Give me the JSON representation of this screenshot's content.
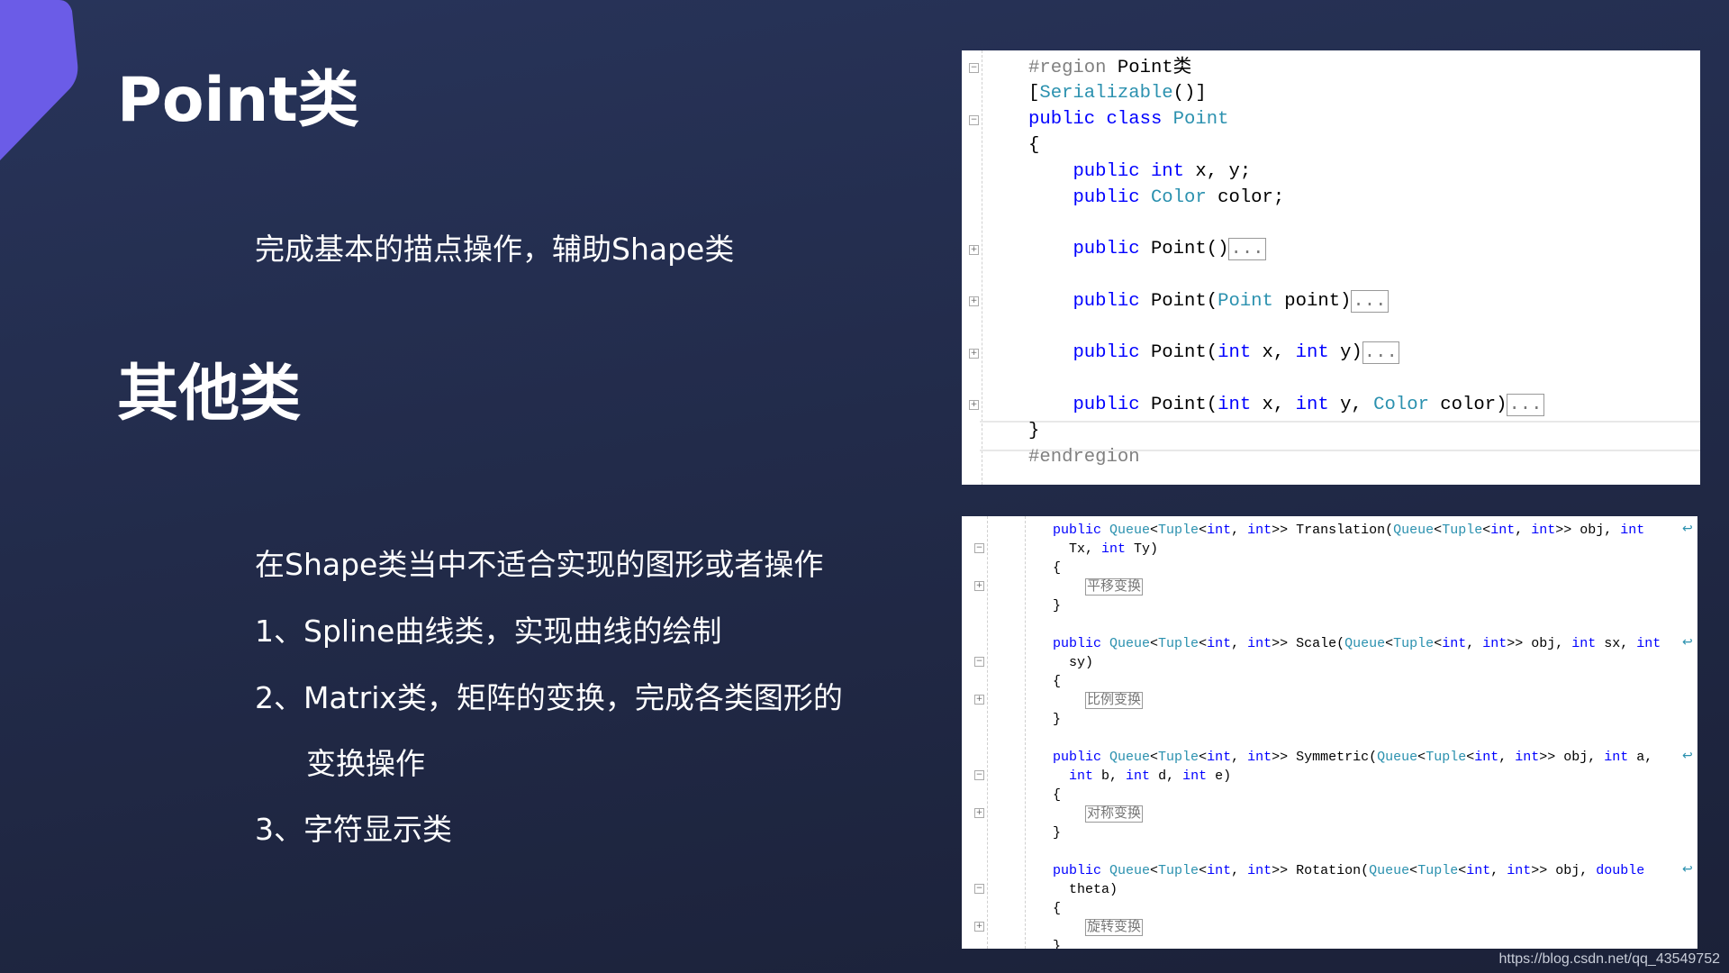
{
  "colors": {
    "accent": "#6b5ce7",
    "keyword": "#0000ff",
    "type": "#2b91af",
    "preprocessor": "#808080"
  },
  "slide": {
    "title1": "Point类",
    "desc1": "完成基本的描点操作，辅助Shape类",
    "title2": "其他类",
    "desc2": "在Shape类当中不适合实现的图形或者操作",
    "items": [
      "1、Spline曲线类，实现曲线的绘制",
      "2、Matrix类，矩阵的变换，完成各类图形的",
      "变换操作",
      "3、字符显示类"
    ]
  },
  "code_top": [
    [
      [
        "#region ",
        "pre"
      ],
      [
        "Point类",
        "pl"
      ]
    ],
    [
      [
        "[",
        "pl"
      ],
      [
        "Serializable",
        "ty"
      ],
      [
        "()]",
        "pl"
      ]
    ],
    [
      [
        "public class ",
        "kw"
      ],
      [
        "Point",
        "ty"
      ]
    ],
    [
      [
        "{",
        "pl"
      ]
    ],
    [
      [
        "    ",
        "pl"
      ],
      [
        "public int ",
        "kw"
      ],
      [
        "x, y;",
        "pl"
      ]
    ],
    [
      [
        "    ",
        "pl"
      ],
      [
        "public ",
        "kw"
      ],
      [
        "Color ",
        "ty"
      ],
      [
        "color;",
        "pl"
      ]
    ],
    [],
    [
      [
        "    ",
        "pl"
      ],
      [
        "public ",
        "kw"
      ],
      [
        "Point()",
        "pl"
      ],
      [
        "...",
        "col"
      ]
    ],
    [],
    [
      [
        "    ",
        "pl"
      ],
      [
        "public ",
        "kw"
      ],
      [
        "Point(",
        "pl"
      ],
      [
        "Point ",
        "ty"
      ],
      [
        "point)",
        "pl"
      ],
      [
        "...",
        "col"
      ]
    ],
    [],
    [
      [
        "    ",
        "pl"
      ],
      [
        "public ",
        "kw"
      ],
      [
        "Point(",
        "pl"
      ],
      [
        "int ",
        "kw"
      ],
      [
        "x, ",
        "pl"
      ],
      [
        "int ",
        "kw"
      ],
      [
        "y)",
        "pl"
      ],
      [
        "...",
        "col"
      ]
    ],
    [],
    [
      [
        "    ",
        "pl"
      ],
      [
        "public ",
        "kw"
      ],
      [
        "Point(",
        "pl"
      ],
      [
        "int ",
        "kw"
      ],
      [
        "x, ",
        "pl"
      ],
      [
        "int ",
        "kw"
      ],
      [
        "y, ",
        "pl"
      ],
      [
        "Color ",
        "ty"
      ],
      [
        "color)",
        "pl"
      ],
      [
        "...",
        "col"
      ]
    ],
    [
      [
        "}",
        "pl"
      ]
    ],
    [
      [
        "#endregion",
        "pre"
      ]
    ]
  ],
  "code_bottom": [
    [
      [
        "public ",
        "kw"
      ],
      [
        "Queue",
        "ty"
      ],
      [
        "<",
        "pl"
      ],
      [
        "Tuple",
        "ty"
      ],
      [
        "<",
        "pl"
      ],
      [
        "int",
        "kw"
      ],
      [
        ", ",
        "pl"
      ],
      [
        "int",
        "kw"
      ],
      [
        ">> Translation(",
        "pl"
      ],
      [
        "Queue",
        "ty"
      ],
      [
        "<",
        "pl"
      ],
      [
        "Tuple",
        "ty"
      ],
      [
        "<",
        "pl"
      ],
      [
        "int",
        "kw"
      ],
      [
        ", ",
        "pl"
      ],
      [
        "int",
        "kw"
      ],
      [
        ">> obj, ",
        "pl"
      ],
      [
        "int",
        "kw"
      ]
    ],
    [
      [
        "  Tx, ",
        "pl"
      ],
      [
        "int ",
        "kw"
      ],
      [
        "Ty)",
        "pl"
      ]
    ],
    [
      [
        "{",
        "pl"
      ]
    ],
    [
      [
        "    ",
        "pl"
      ],
      [
        "平移变换",
        "col"
      ]
    ],
    [
      [
        "}",
        "pl"
      ]
    ],
    [],
    [
      [
        "public ",
        "kw"
      ],
      [
        "Queue",
        "ty"
      ],
      [
        "<",
        "pl"
      ],
      [
        "Tuple",
        "ty"
      ],
      [
        "<",
        "pl"
      ],
      [
        "int",
        "kw"
      ],
      [
        ", ",
        "pl"
      ],
      [
        "int",
        "kw"
      ],
      [
        ">> Scale(",
        "pl"
      ],
      [
        "Queue",
        "ty"
      ],
      [
        "<",
        "pl"
      ],
      [
        "Tuple",
        "ty"
      ],
      [
        "<",
        "pl"
      ],
      [
        "int",
        "kw"
      ],
      [
        ", ",
        "pl"
      ],
      [
        "int",
        "kw"
      ],
      [
        ">> obj, ",
        "pl"
      ],
      [
        "int ",
        "kw"
      ],
      [
        "sx, ",
        "pl"
      ],
      [
        "int",
        "kw"
      ]
    ],
    [
      [
        "  sy)",
        "pl"
      ]
    ],
    [
      [
        "{",
        "pl"
      ]
    ],
    [
      [
        "    ",
        "pl"
      ],
      [
        "比例变换",
        "col"
      ]
    ],
    [
      [
        "}",
        "pl"
      ]
    ],
    [],
    [
      [
        "public ",
        "kw"
      ],
      [
        "Queue",
        "ty"
      ],
      [
        "<",
        "pl"
      ],
      [
        "Tuple",
        "ty"
      ],
      [
        "<",
        "pl"
      ],
      [
        "int",
        "kw"
      ],
      [
        ", ",
        "pl"
      ],
      [
        "int",
        "kw"
      ],
      [
        ">> Symmetric(",
        "pl"
      ],
      [
        "Queue",
        "ty"
      ],
      [
        "<",
        "pl"
      ],
      [
        "Tuple",
        "ty"
      ],
      [
        "<",
        "pl"
      ],
      [
        "int",
        "kw"
      ],
      [
        ", ",
        "pl"
      ],
      [
        "int",
        "kw"
      ],
      [
        ">> obj, ",
        "pl"
      ],
      [
        "int ",
        "kw"
      ],
      [
        "a,",
        "pl"
      ]
    ],
    [
      [
        "  ",
        "pl"
      ],
      [
        "int ",
        "kw"
      ],
      [
        "b, ",
        "pl"
      ],
      [
        "int ",
        "kw"
      ],
      [
        "d, ",
        "pl"
      ],
      [
        "int ",
        "kw"
      ],
      [
        "e)",
        "pl"
      ]
    ],
    [
      [
        "{",
        "pl"
      ]
    ],
    [
      [
        "    ",
        "pl"
      ],
      [
        "对称变换",
        "col"
      ]
    ],
    [
      [
        "}",
        "pl"
      ]
    ],
    [],
    [
      [
        "public ",
        "kw"
      ],
      [
        "Queue",
        "ty"
      ],
      [
        "<",
        "pl"
      ],
      [
        "Tuple",
        "ty"
      ],
      [
        "<",
        "pl"
      ],
      [
        "int",
        "kw"
      ],
      [
        ", ",
        "pl"
      ],
      [
        "int",
        "kw"
      ],
      [
        ">> Rotation(",
        "pl"
      ],
      [
        "Queue",
        "ty"
      ],
      [
        "<",
        "pl"
      ],
      [
        "Tuple",
        "ty"
      ],
      [
        "<",
        "pl"
      ],
      [
        "int",
        "kw"
      ],
      [
        ", ",
        "pl"
      ],
      [
        "int",
        "kw"
      ],
      [
        ">> obj, ",
        "pl"
      ],
      [
        "double",
        "kw"
      ]
    ],
    [
      [
        "  theta)",
        "pl"
      ]
    ],
    [
      [
        "{",
        "pl"
      ]
    ],
    [
      [
        "    ",
        "pl"
      ],
      [
        "旋转变换",
        "col"
      ]
    ],
    [
      [
        "}",
        "pl"
      ]
    ]
  ],
  "fold_top": [
    "minus",
    null,
    "minus",
    null,
    null,
    null,
    null,
    "plus",
    null,
    "plus",
    null,
    "plus",
    null,
    "plus",
    null,
    null
  ],
  "fold_bottom": [
    null,
    "minus",
    null,
    "plus",
    null,
    null,
    null,
    "minus",
    null,
    "plus",
    null,
    null,
    null,
    "minus",
    null,
    "plus",
    null,
    null,
    null,
    "minus",
    null,
    "plus",
    null
  ],
  "wrap_bottom": [
    0,
    6,
    12,
    18
  ],
  "watermark": "https://blog.csdn.net/qq_43549752"
}
